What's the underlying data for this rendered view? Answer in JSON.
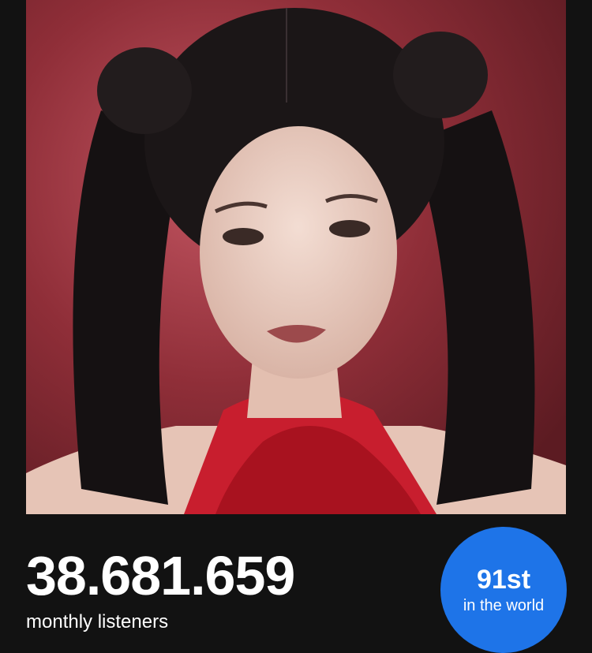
{
  "artist_photo": {
    "icon": "artist-portrait-image"
  },
  "stats": {
    "monthly_listeners": "38.681.659",
    "monthly_listeners_label": "monthly listeners"
  },
  "rank": {
    "value": "91st",
    "caption": "in the world",
    "color": "#1e74e8"
  },
  "colors": {
    "background": "#121212",
    "photo_backdrop": "#8a2b34",
    "text": "#ffffff"
  }
}
